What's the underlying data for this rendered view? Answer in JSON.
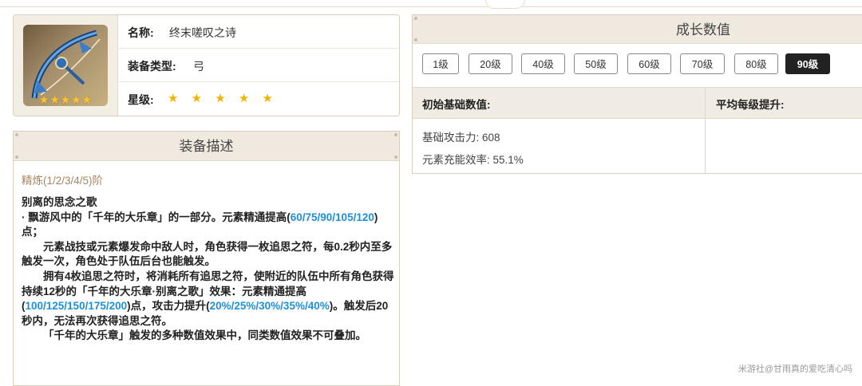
{
  "item": {
    "name_label": "名称:",
    "name": "终末嗟叹之诗",
    "type_label": "装备类型:",
    "type": "弓",
    "rarity_label": "星级:",
    "rarity_stars": "★ ★ ★ ★ ★",
    "icon_stars": "★★★★★"
  },
  "description": {
    "title": "装备描述",
    "refine": "精炼(1/2/3/4/5)阶",
    "skill_name": "别离的思念之歌",
    "p1a": "· 飘游风中的「千年的大乐章」的一部分。元素精通提高(",
    "p1_hl": "60/75/90/105/120",
    "p1b": ")点；",
    "p2": "元素战技或元素爆发命中敌人时，角色获得一枚追思之符，每0.2秒内至多触发一次，角色处于队伍后台也能触发。",
    "p3a": "拥有4枚追思之符时，将消耗所有追思之符，使附近的队伍中所有角色获得持续12秒的「千年的大乐章·别离之歌」效果：元素精通提高(",
    "p3_hl1": "100/125/150/175/200",
    "p3b": ")点，攻击力提升(",
    "p3_hl2": "20%/25%/30%/35%/40%",
    "p3c": ")。触发后20秒内，无法再次获得追思之符。",
    "p4": "「千年的大乐章」触发的多种数值效果中，同类数值效果不可叠加。"
  },
  "growth": {
    "title": "成长数值",
    "levels": [
      "1级",
      "20级",
      "40级",
      "50级",
      "60级",
      "70级",
      "80级",
      "90级"
    ],
    "selected_level": "90级",
    "col_base": "初始基础数值:",
    "col_avg": "平均每级提升:",
    "stat_atk": "基础攻击力: 608",
    "stat_er": "元素充能效率: 55.1%"
  },
  "watermark": "米游社@甘雨真的爱吃清心吗",
  "colors": {
    "highlight": "#1f8fd8",
    "refine": "#a88560",
    "star": "#f2b400",
    "panel_header": "#efe9df"
  }
}
